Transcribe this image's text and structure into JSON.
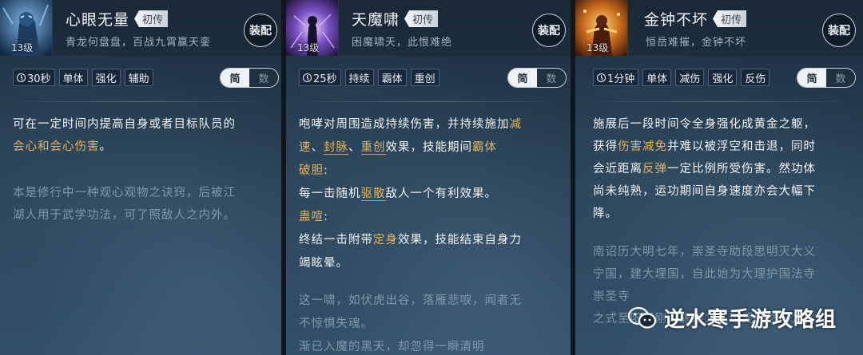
{
  "cards": [
    {
      "name": "心眼无量",
      "rank": "初传",
      "subtitle": "青龙何盘盘，百战九霄赢天銮",
      "level": "13级",
      "equip_label": "装配",
      "tags": [
        "30秒",
        "单体",
        "强化",
        "辅助"
      ],
      "toggle": {
        "simple": "简",
        "numeric": "数"
      },
      "desc": {
        "l1": "可在一定时间内提高自身或者目标队员的",
        "l2_hl": "会心和会心伤害",
        "l2_end": "。"
      },
      "lore": [
        "本是修行中一种观心观物之诀窍，后被江",
        "湖人用于武学功法，可了照敌人之内外。"
      ]
    },
    {
      "name": "天魔啸",
      "rank": "初传",
      "subtitle": "困魔啸天，此恨难绝",
      "level": "13级",
      "equip_label": "装配",
      "tags": [
        "25秒",
        "持续",
        "霸体",
        "重创"
      ],
      "toggle": {
        "simple": "简",
        "numeric": "数"
      },
      "desc": {
        "l1_a": "咆哮对周围造成持续伤害，并持续施加",
        "l1_b": "减",
        "l2_a": "速",
        "l2_b": "、",
        "l2_c": "封脉",
        "l2_d": "、",
        "l2_e": "重创",
        "l2_f": "效果，技能期间",
        "l2_g": "霸体",
        "l3": "破胆",
        "l3_colon": ":",
        "l4_a": "每一击随机",
        "l4_b": "驱散",
        "l4_c": "敌人一个有利效果。",
        "l5": "蛊喧",
        "l5_colon": ":",
        "l6_a": "终结一击附带",
        "l6_b": "定身",
        "l6_c": "效果，技能结束自身力",
        "l7": "竭眩晕。"
      },
      "lore": [
        "这一啸，如伏虎出谷，落雁悲唳，闻者无",
        "不惊惧失魂。",
        "渐已入魔的黑天，却忽得一瞬清明"
      ]
    },
    {
      "name": "金钟不坏",
      "rank": "初传",
      "subtitle": "恒岳难摧，金钟不坏",
      "level": "13级",
      "equip_label": "装配",
      "tags": [
        "1分钟",
        "单体",
        "减伤",
        "强化",
        "反伤"
      ],
      "toggle": {
        "simple": "简",
        "numeric": "数"
      },
      "desc": {
        "l1": "施展后一段时间令全身强化成黄金之躯，",
        "l2_a": "获得",
        "l2_b": "伤害减免",
        "l2_c": "并难以被浮空和击退，同时",
        "l3_a": "会近距离",
        "l3_b": "反弹",
        "l3_c": "一定比例所受伤害。然功体",
        "l4": "尚未纯熟，运功期间自身速度亦会大幅下",
        "l5": "降。"
      },
      "lore": [
        "南诏历大明七年，崇圣寺助段思明灭大义",
        "宁国，建大理国，自此始为大理护国法寺",
        "崇圣寺",
        "之式至阳至刚，施展之人可凭纯然内力化"
      ]
    }
  ],
  "watermark": {
    "text": "逆水寒手游攻略组",
    "icon": "wechat-icon"
  }
}
